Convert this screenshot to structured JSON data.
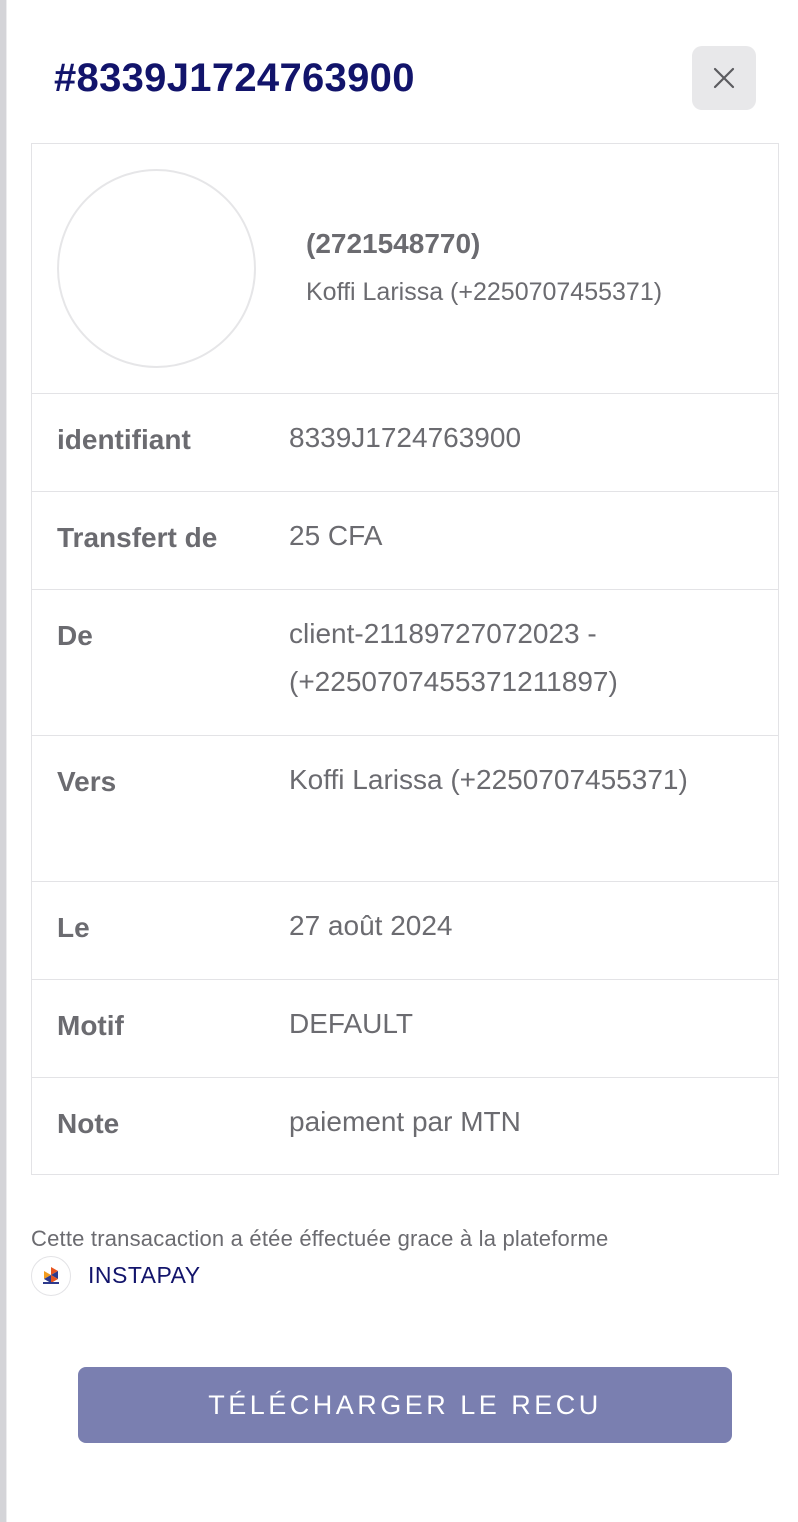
{
  "header": {
    "title": "#8339J1724763900",
    "close_icon": "close-icon"
  },
  "recipient": {
    "id": "(2721548770)",
    "name": "Koffi Larissa (+2250707455371)"
  },
  "details": [
    {
      "label": "identifiant",
      "value": "8339J1724763900"
    },
    {
      "label": "Transfert de",
      "value": "25 CFA"
    },
    {
      "label": "De",
      "value": "client-21189727072023 - (+2250707455371211897)"
    },
    {
      "label": "Vers",
      "value": "Koffi Larissa (+2250707455371)"
    },
    {
      "label": "Le",
      "value": "27 août 2024"
    },
    {
      "label": "Motif",
      "value": "DEFAULT"
    },
    {
      "label": "Note",
      "value": "paiement par MTN"
    }
  ],
  "footer": {
    "text": "Cette transacaction a étée éffectuée grace à la plateforme",
    "brand_name": "INSTAPAY"
  },
  "download_button": {
    "label": "TÉLÉCHARGER LE RECU"
  },
  "colors": {
    "title": "#12146b",
    "button_bg": "#7a7fb0",
    "text": "#6b6b70",
    "border": "#e3e3e6"
  }
}
